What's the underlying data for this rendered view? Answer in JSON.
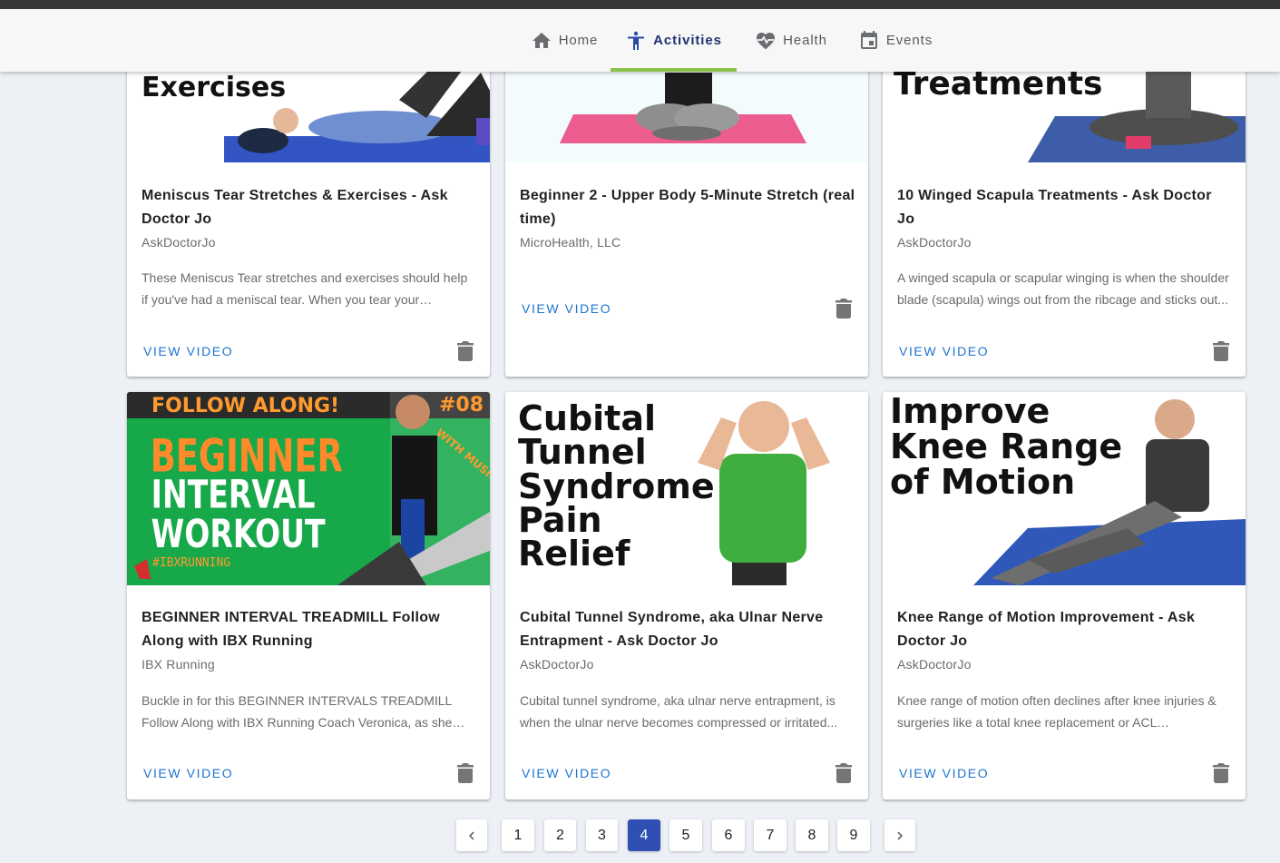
{
  "nav": {
    "tabs": [
      {
        "label": "Home",
        "icon": "home-icon"
      },
      {
        "label": "Activities",
        "icon": "activity-figure-icon",
        "active": true
      },
      {
        "label": "Health",
        "icon": "heartbeat-icon"
      },
      {
        "label": "Events",
        "icon": "calendar-icon"
      }
    ],
    "accent_color": "#8bc34a"
  },
  "cards": [
    {
      "thumb_text": [
        "Exercises"
      ],
      "title": "Meniscus Tear Stretches & Exercises - Ask Doctor Jo",
      "author": "AskDoctorJo",
      "description": "These Meniscus Tear stretches and exercises should help if you've had a meniscal tear. When you tear your meniscus...",
      "button": "VIEW VIDEO"
    },
    {
      "thumb_text": [],
      "title": "Beginner 2 - Upper Body 5-Minute Stretch (real time)",
      "author": "MicroHealth, LLC",
      "description": "",
      "button": "VIEW VIDEO"
    },
    {
      "thumb_text": [
        "Treatments"
      ],
      "title": "10 Winged Scapula Treatments - Ask Doctor Jo",
      "author": "AskDoctorJo",
      "description": "A winged scapula or scapular winging is when the shoulder blade (scapula) wings out from the ribcage and sticks out...",
      "button": "VIEW VIDEO"
    },
    {
      "thumb_text": [
        "FOLLOW ALONG!",
        "#08",
        "BEGINNER",
        "INTERVAL",
        "WORKOUT",
        "#IBXRUNNING",
        "WITH MUSIC!"
      ],
      "title": "BEGINNER INTERVAL TREADMILL Follow Along with IBX Running",
      "author": "IBX Running",
      "description": "Buckle in for this BEGINNER INTERVALS TREADMILL Follow Along with IBX Running Coach Veronica, as she takes you...",
      "button": "VIEW VIDEO"
    },
    {
      "thumb_text": [
        "Cubital",
        "Tunnel",
        "Syndrome",
        "Pain",
        "Relief"
      ],
      "title": "Cubital Tunnel Syndrome, aka Ulnar Nerve Entrapment - Ask Doctor Jo",
      "author": "AskDoctorJo",
      "description": "Cubital tunnel syndrome, aka ulnar nerve entrapment, is when the ulnar nerve becomes compressed or irritated...",
      "button": "VIEW VIDEO"
    },
    {
      "thumb_text": [
        "Improve",
        "Knee Range",
        "of Motion"
      ],
      "title": "Knee Range of Motion Improvement - Ask Doctor Jo",
      "author": "AskDoctorJo",
      "description": "Knee range of motion often declines after knee injuries & surgeries like a total knee replacement or ACL reconstruction...",
      "button": "VIEW VIDEO"
    }
  ],
  "pagination": {
    "pages": [
      "1",
      "2",
      "3",
      "4",
      "5",
      "6",
      "7",
      "8",
      "9"
    ],
    "current": "4",
    "prev_icon": "chevron-left-icon",
    "next_icon": "chevron-right-icon",
    "active_color": "#2f4fb5"
  }
}
